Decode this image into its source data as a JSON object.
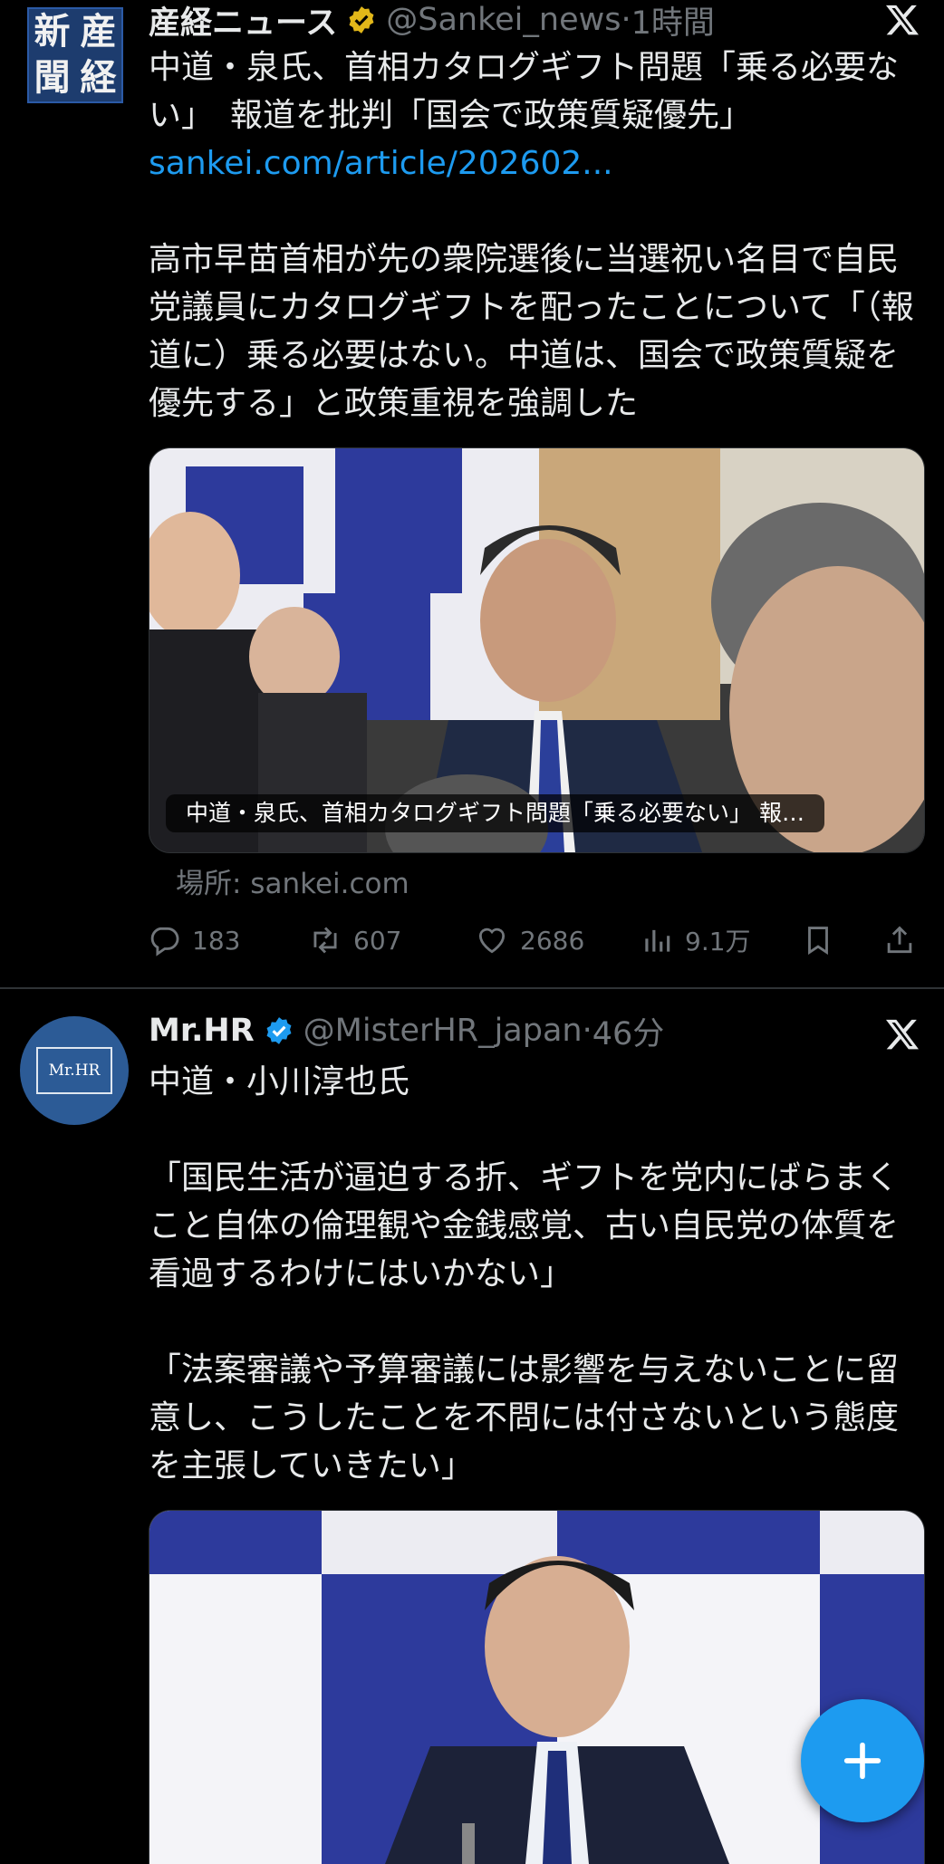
{
  "colors": {
    "background": "#000000",
    "text": "#e7e9ea",
    "muted": "#71767b",
    "link": "#1d9bf0",
    "verified_gold": "#e2b719",
    "verified_blue": "#1d9bf0"
  },
  "tweets": [
    {
      "avatar_chars": [
        "新",
        "産",
        "聞",
        "経"
      ],
      "name": "産経ニュース",
      "badge": "verified-gold-icon",
      "handle": "@Sankei_news",
      "dot": "·",
      "time": "1時間",
      "text_line1": "中道・泉氏、首相カタログギフト問題「乗る必要ない」　報道を批判「国会で政策質疑優先」",
      "link": "sankei.com/article/202602...",
      "text_body": "高市早苗首相が先の衆院選後に当選祝い名目で自民党議員にカタログギフトを配ったことについて「（報道に）乗る必要はない。中道は、国会で政策質疑を優先する」と政策重視を強調した",
      "card_caption": "中道・泉氏、首相カタログギフト問題「乗る必要ない」 報…",
      "source": "場所: sankei.com",
      "metrics": {
        "replies": "183",
        "retweets": "607",
        "likes": "2686",
        "views": "9.1万"
      }
    },
    {
      "avatar_text": "Mr.HR",
      "name": "Mr.HR",
      "badge": "verified-blue-icon",
      "handle": "@MisterHR_japan",
      "dot": "·",
      "time": "46分",
      "text": "中道・小川淳也氏\n\n「国民生活が逼迫する折、ギフトを党内にばらまくこと自体の倫理観や金銭感覚、古い自民党の体質を看過するわけにはいかない」\n\n「法案審議や予算審議には影響を与えないことに留意し、こうしたことを不問には付さないという態度を主張していきたい」"
    }
  ]
}
